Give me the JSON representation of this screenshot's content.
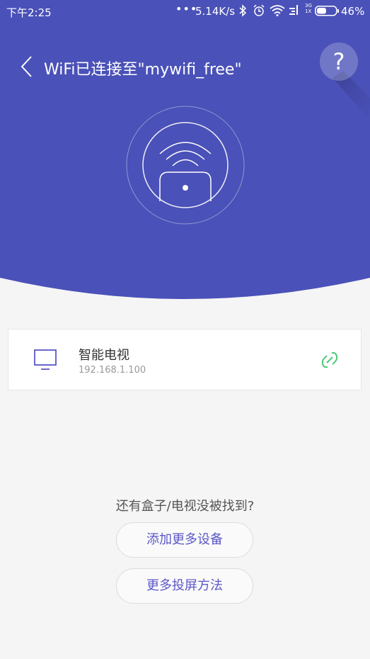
{
  "colors": {
    "header": "#4a51b8",
    "accent": "#5b57c8",
    "link_green": "#4cc77a",
    "background": "#f5f5f5"
  },
  "status_bar": {
    "time": "下午2:25",
    "dots": "•••",
    "network_speed": "5.14K/s",
    "network_type_top": "3G",
    "network_type_bottom": "1X",
    "battery": "46%",
    "icons": [
      "bluetooth-icon",
      "alarm-icon",
      "wifi-icon",
      "signal-icon",
      "battery-icon"
    ]
  },
  "header": {
    "title": "WiFi已连接至\"mywifi_free\"",
    "help_label": "?"
  },
  "device": {
    "name": "智能电视",
    "ip": "192.168.1.100",
    "icon": "tv-icon",
    "action_icon": "link-icon"
  },
  "footer": {
    "not_found_text": "还有盒子/电视没被找到?",
    "add_device_label": "添加更多设备",
    "more_methods_label": "更多投屏方法"
  }
}
